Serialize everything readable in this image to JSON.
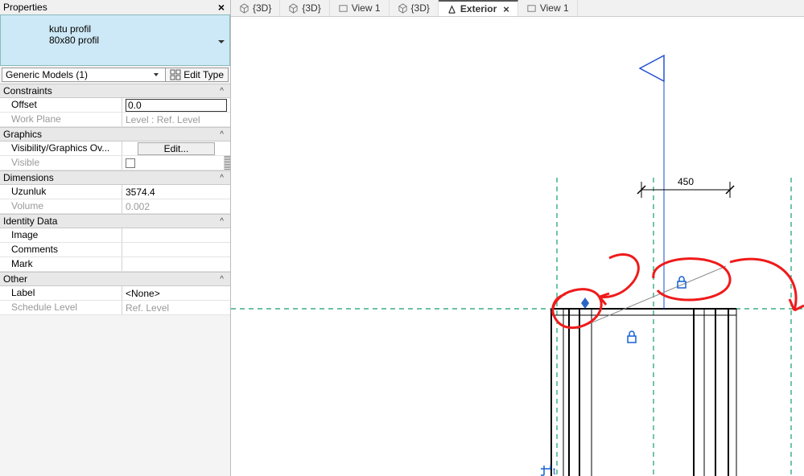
{
  "panel": {
    "title": "Properties",
    "type_line1": "kutu profil",
    "type_line2": "80x80 profil",
    "instance_select": "Generic Models (1)",
    "edit_type_label": "Edit Type",
    "groups": {
      "constraints": {
        "header": "Constraints",
        "offset_label": "Offset",
        "offset_value": "0.0",
        "workplane_label": "Work Plane",
        "workplane_value": "Level : Ref. Level"
      },
      "graphics": {
        "header": "Graphics",
        "vgo_label": "Visibility/Graphics Ov...",
        "vgo_btn": "Edit...",
        "visible_label": "Visible"
      },
      "dimensions": {
        "header": "Dimensions",
        "uzunluk_label": "Uzunluk",
        "uzunluk_value": "3574.4",
        "volume_label": "Volume",
        "volume_value": "0.002"
      },
      "identity": {
        "header": "Identity Data",
        "image_label": "Image",
        "comments_label": "Comments",
        "mark_label": "Mark"
      },
      "other": {
        "header": "Other",
        "label_label": "Label",
        "label_value": "<None>",
        "schedule_label": "Schedule Level",
        "schedule_value": "Ref. Level"
      }
    }
  },
  "tabs": [
    {
      "kind": "3d",
      "label": "{3D}",
      "active": false
    },
    {
      "kind": "3d",
      "label": "{3D}",
      "active": false
    },
    {
      "kind": "view",
      "label": "View 1",
      "active": false
    },
    {
      "kind": "3d",
      "label": "{3D}",
      "active": false
    },
    {
      "kind": "elev",
      "label": "Exterior",
      "active": true
    },
    {
      "kind": "view",
      "label": "View 1",
      "active": false
    }
  ],
  "drawing": {
    "dimension_text": "450",
    "cursor_label": "t"
  },
  "icons": {
    "lock": "lock-icon",
    "crop": "crop-icon",
    "elev_marker": "elevation-marker-icon",
    "drag": "drag-handle-icon"
  }
}
